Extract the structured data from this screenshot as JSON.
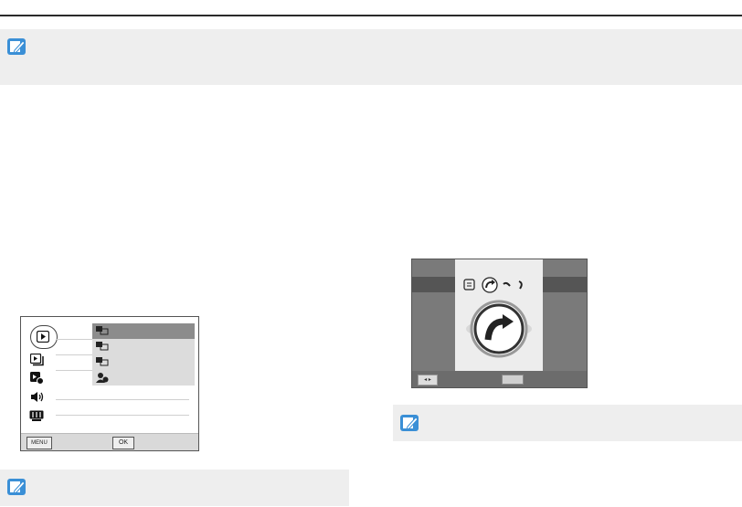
{
  "left_screen": {
    "bottom_menu_label": "MENU",
    "bottom_ok_label": "OK"
  },
  "colors": {
    "note_bg": "#eeeeee",
    "note_icon": "#3a8fd6",
    "screen_selected": "#8c8c8c"
  },
  "icons": [
    "note-icon",
    "playback-icon",
    "slideshow-icon",
    "file-icon",
    "sound-icon",
    "display-icon",
    "rotate-icon"
  ]
}
